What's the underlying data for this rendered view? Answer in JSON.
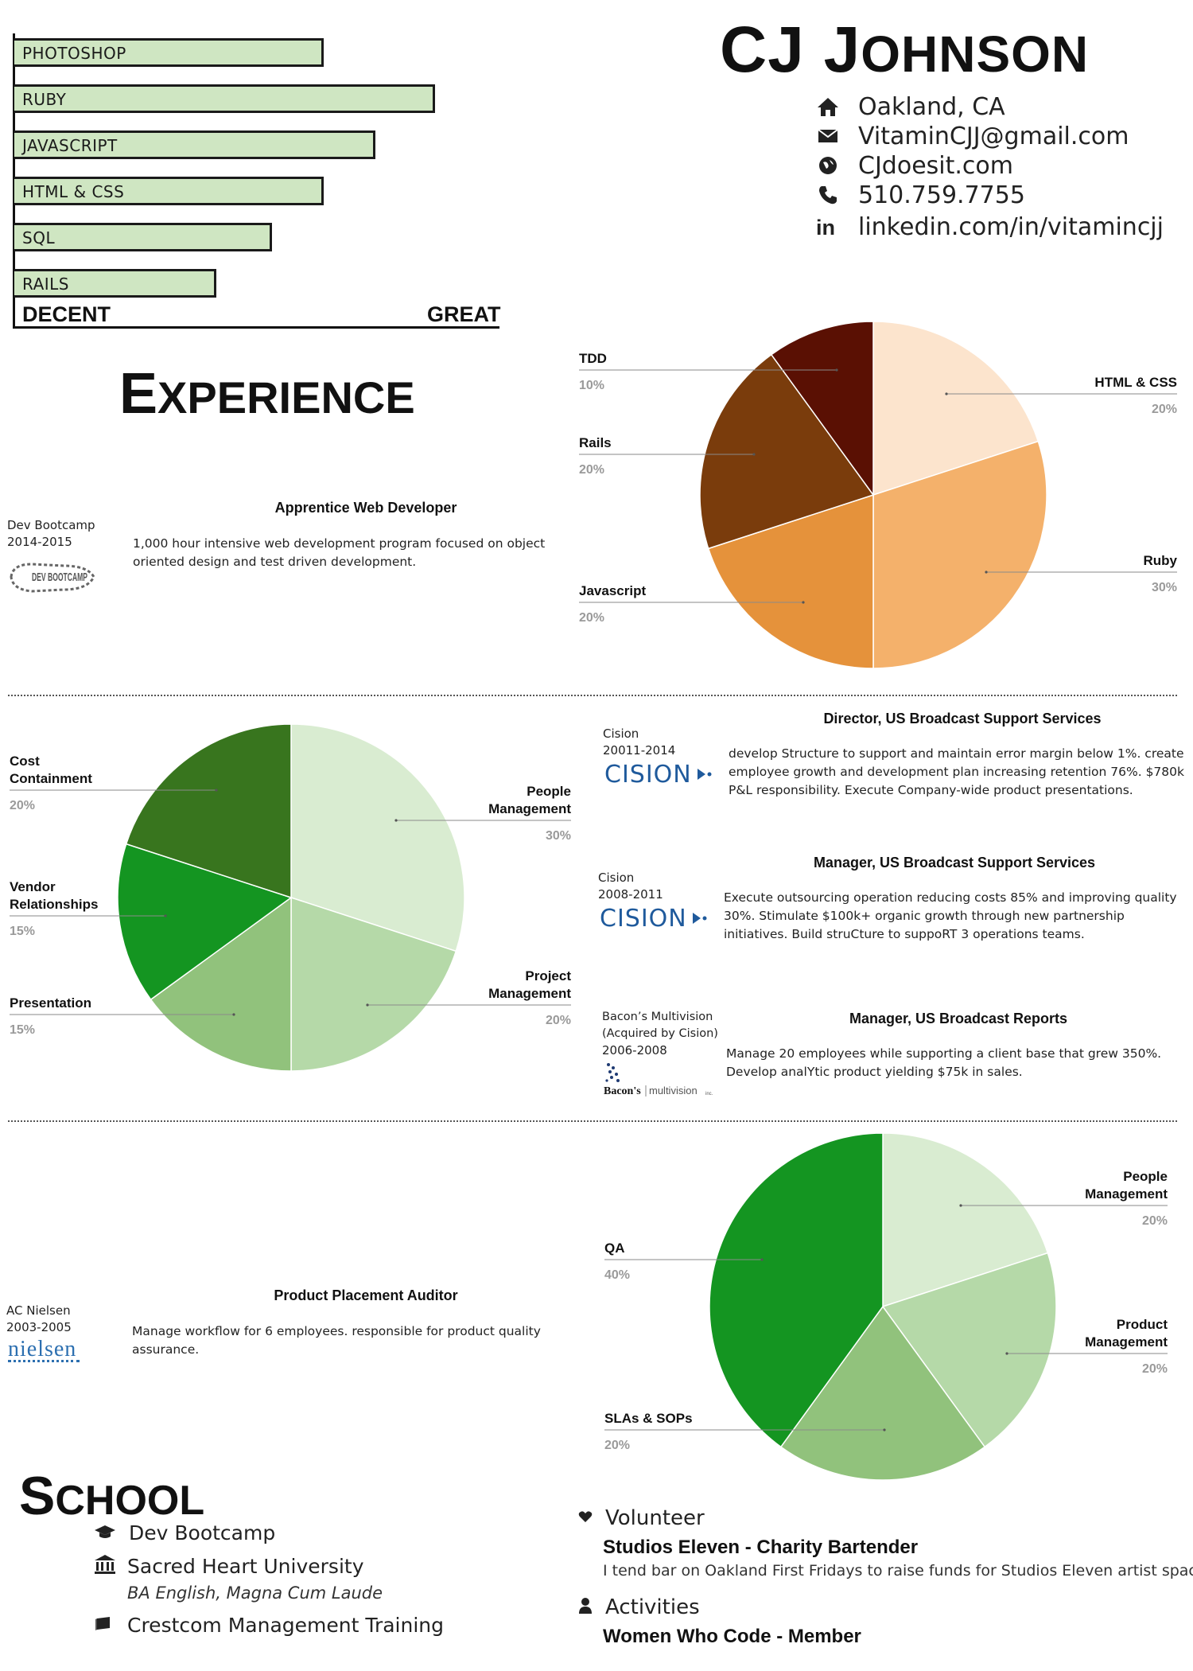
{
  "skills": {
    "items": [
      {
        "label": "PHOTOSHOP",
        "level": 0.72
      },
      {
        "label": "RUBY",
        "level": 0.98
      },
      {
        "label": "JAVASCRIPT",
        "level": 0.84
      },
      {
        "label": "HTML & CSS",
        "level": 0.72
      },
      {
        "label": "SQL",
        "level": 0.6
      },
      {
        "label": "RAILS",
        "level": 0.47
      }
    ],
    "scale_low": "DECENT",
    "scale_high": "GREAT"
  },
  "header": {
    "name_first": "CJ",
    "name_last_cap": "J",
    "name_last_rest": "OHNSON",
    "contacts": [
      {
        "icon": "home-icon",
        "text": "Oakland, CA"
      },
      {
        "icon": "envelope-icon",
        "text": "VitaminCJJ@gmail.com"
      },
      {
        "icon": "globe-icon",
        "text": "CJdoesit.com"
      },
      {
        "icon": "phone-icon",
        "text": "510.759.7755"
      },
      {
        "icon": "linkedin-icon",
        "text": "linkedin.com/in/vitamincjj"
      }
    ]
  },
  "experience": {
    "title_cap": "E",
    "title_rest": "XPERIENCE",
    "jobs": [
      {
        "company": "Dev Bootcamp",
        "years": "2014-2015",
        "logo": "DEV BOOTCAMP",
        "title": "Apprentice Web Developer",
        "desc": "1,000 hour intensive web development program focused on object oriented design and test driven development."
      },
      {
        "company": "Cision",
        "years": "20011-2014",
        "logo": "CISION",
        "title": "Director, US Broadcast Support Services",
        "desc": "develop Structure to support and maintain error margin below 1%. create employee growth and development plan increasing retention 76%. $780k P&L responsibility. Execute Company-wide product presentations."
      },
      {
        "company": "Cision",
        "years": "2008-2011",
        "logo": "CISION",
        "title": "Manager, US Broadcast Support Services",
        "desc": "Execute outsourcing operation reducing costs 85% and improving quality 30%. Stimulate $100k+ organic growth through new partnership initiatives. Build struCture to suppoRT 3 operations teams."
      },
      {
        "company": "Bacon’s Multivision",
        "company_note": "(Acquired by Cision)",
        "years": "2006-2008",
        "logo_a": "Bacon's",
        "logo_b": "multivision",
        "logo_c": "inc.",
        "title": "Manager, US Broadcast Reports",
        "desc": "Manage 20 employees while supporting a client base that grew 350%. Develop analYtic product yielding $75k in sales."
      },
      {
        "company": "AC Nielsen",
        "years": "2003-2005",
        "logo": "nielsen",
        "title": "Product Placement Auditor",
        "desc": "Manage workflow for 6 employees.  responsible for product quality assurance."
      }
    ]
  },
  "chart_data": [
    {
      "type": "pie",
      "slices": [
        {
          "label": "HTML & CSS",
          "pct_label": "20%",
          "value": 20,
          "color": "#fce4cd"
        },
        {
          "label": "Ruby",
          "pct_label": "30%",
          "value": 30,
          "color": "#f4b16b"
        },
        {
          "label": "Javascript",
          "pct_label": "20%",
          "value": 20,
          "color": "#e5923b"
        },
        {
          "label": "Rails",
          "pct_label": "20%",
          "value": 20,
          "color": "#7a3c0c"
        },
        {
          "label": "TDD",
          "pct_label": "10%",
          "value": 10,
          "color": "#5a1003"
        }
      ]
    },
    {
      "type": "pie",
      "slices": [
        {
          "label": "People Management",
          "pct_label": "30%",
          "value": 30,
          "color": "#d9ecd1"
        },
        {
          "label": "Project Management",
          "pct_label": "20%",
          "value": 20,
          "color": "#b5d9a8"
        },
        {
          "label": "Presentation",
          "pct_label": "15%",
          "value": 15,
          "color": "#91c27c"
        },
        {
          "label": "Vendor Relationships",
          "pct_label": "15%",
          "value": 15,
          "color": "#149521"
        },
        {
          "label": "Cost Containment",
          "pct_label": "20%",
          "value": 20,
          "color": "#38751e"
        }
      ]
    },
    {
      "type": "pie",
      "slices": [
        {
          "label": "People Management",
          "pct_label": "20%",
          "value": 20,
          "color": "#d9ecd1"
        },
        {
          "label": "Product Management",
          "pct_label": "20%",
          "value": 20,
          "color": "#b5d9a8"
        },
        {
          "label": "SLAs & SOPs",
          "pct_label": "20%",
          "value": 20,
          "color": "#91c27c"
        },
        {
          "label": "QA",
          "pct_label": "40%",
          "value": 40,
          "color": "#149521"
        }
      ]
    }
  ],
  "school": {
    "title_cap": "S",
    "title_rest": "CHOOL",
    "items": [
      {
        "icon": "graduation-cap-icon",
        "text": "Dev Bootcamp"
      },
      {
        "icon": "university-icon",
        "text": "Sacred Heart University",
        "sub": "BA English, Magna Cum Laude"
      },
      {
        "icon": "book-icon",
        "text": "Crestcom Management Training"
      }
    ]
  },
  "volunteer": {
    "heading": "Volunteer",
    "role": "Studios Eleven - Charity Bartender",
    "desc": "I tend bar on Oakland First Fridays to raise funds for Studios Eleven artist space"
  },
  "activities": {
    "heading": "Activities",
    "role": "Women Who Code - Member"
  }
}
